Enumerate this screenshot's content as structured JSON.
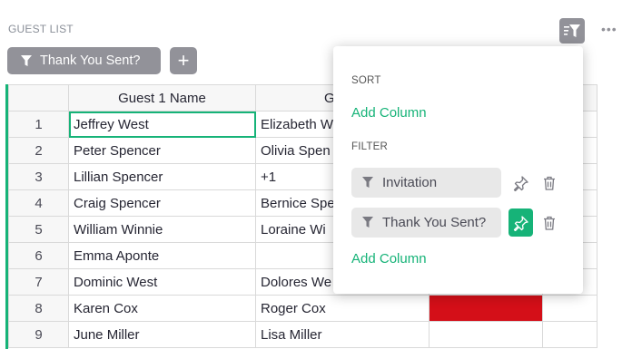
{
  "section": {
    "title": "GUEST LIST"
  },
  "filter_bar": {
    "pill_label": "Thank You Sent?",
    "add_label": "+"
  },
  "toolbar": {
    "more_label": "•••"
  },
  "grid": {
    "columns": [
      "Guest 1 Name",
      "Guest",
      "",
      ""
    ],
    "rows": [
      {
        "num": "1",
        "guest1": "Jeffrey West",
        "guest2": "Elizabeth W"
      },
      {
        "num": "2",
        "guest1": "Peter Spencer",
        "guest2": "Olivia Spen"
      },
      {
        "num": "3",
        "guest1": "Lillian Spencer",
        "guest2": "+1"
      },
      {
        "num": "4",
        "guest1": "Craig Spencer",
        "guest2": "Bernice Spe"
      },
      {
        "num": "5",
        "guest1": "William Winnie",
        "guest2": "Loraine Wi"
      },
      {
        "num": "6",
        "guest1": "Emma Aponte",
        "guest2": ""
      },
      {
        "num": "7",
        "guest1": "Dominic West",
        "guest2": "Dolores We"
      },
      {
        "num": "8",
        "guest1": "Karen Cox",
        "guest2": "Roger Cox"
      },
      {
        "num": "9",
        "guest1": "June Miller",
        "guest2": "Lisa Miller"
      }
    ],
    "highlight_color": "#d40f18"
  },
  "popup": {
    "sort_label": "SORT",
    "sort_add": "Add Column",
    "filter_label": "FILTER",
    "filters": [
      {
        "label": "Invitation",
        "pinned": false
      },
      {
        "label": "Thank You Sent?",
        "pinned": true
      }
    ],
    "filter_add": "Add Column"
  },
  "colors": {
    "accent": "#16b378",
    "pill": "#929299"
  },
  "icons": [
    "filter-icon",
    "sort-filter-icon",
    "pin-icon",
    "trash-icon",
    "plus-icon",
    "more-icon"
  ]
}
